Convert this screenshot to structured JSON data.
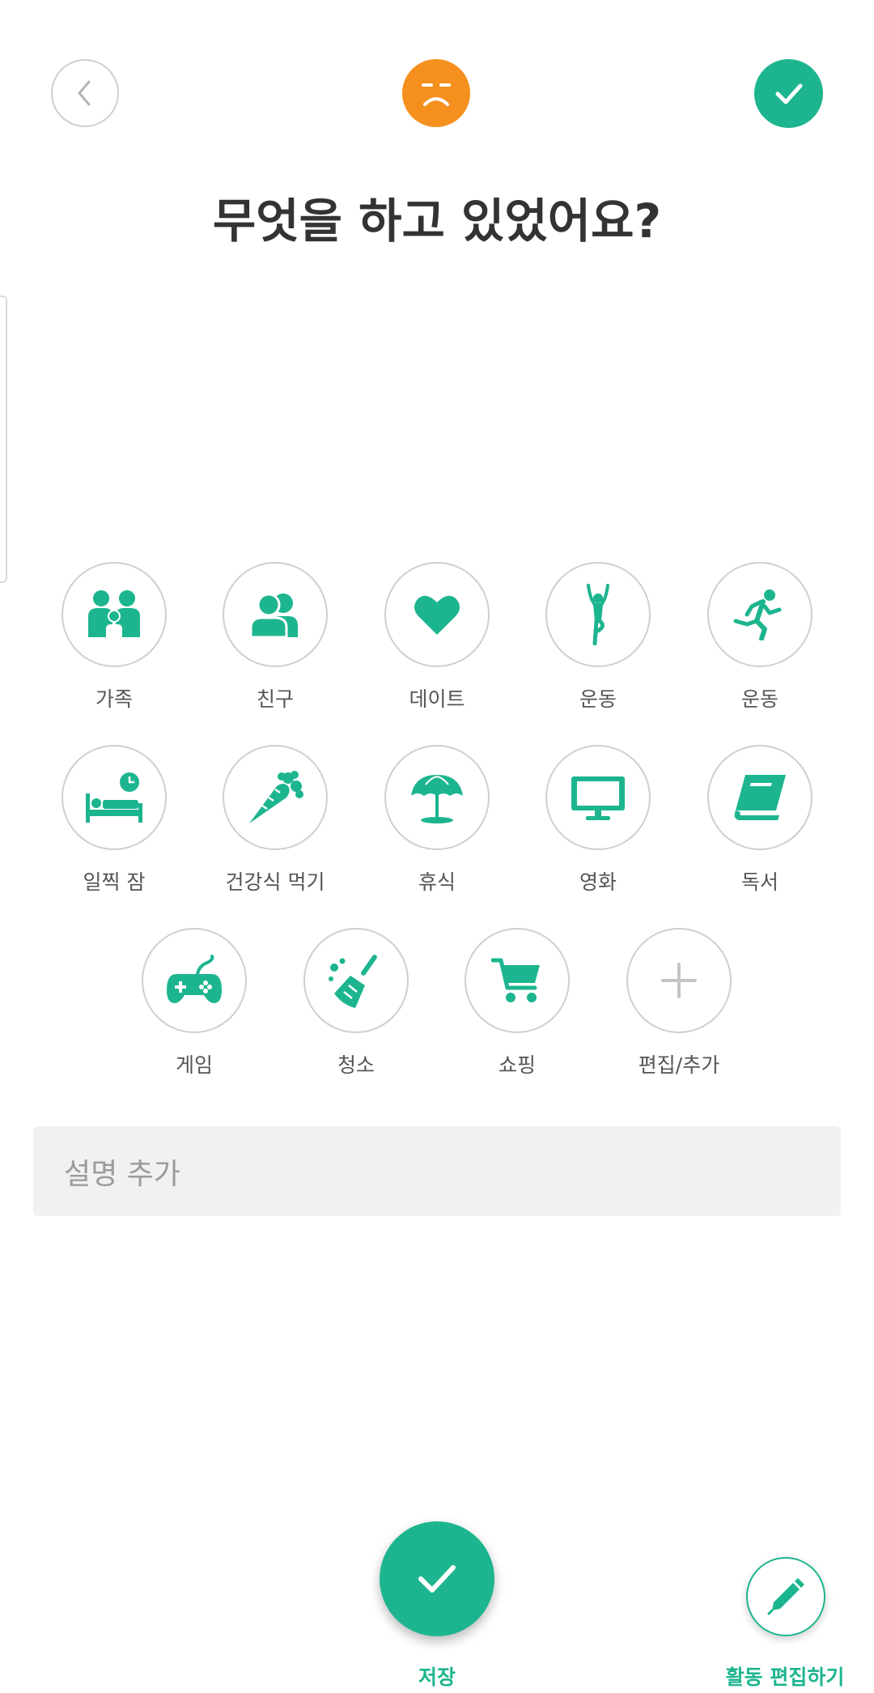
{
  "header": {
    "back_icon": "chevron-left-icon",
    "mood_icon": "sad-face-icon",
    "mood_color": "#f5901f",
    "done_icon": "check-icon",
    "title": "무엇을 하고 있었어요?"
  },
  "accent_color": "#1db58f",
  "activities": [
    {
      "label": "가족",
      "icon": "family-icon"
    },
    {
      "label": "친구",
      "icon": "friends-icon"
    },
    {
      "label": "데이트",
      "icon": "heart-icon"
    },
    {
      "label": "운동",
      "icon": "yoga-icon"
    },
    {
      "label": "운동",
      "icon": "running-icon"
    },
    {
      "label": "일찍 잠",
      "icon": "bed-clock-icon"
    },
    {
      "label": "건강식 먹기",
      "icon": "carrot-icon"
    },
    {
      "label": "휴식",
      "icon": "beach-umbrella-icon"
    },
    {
      "label": "영화",
      "icon": "tv-icon"
    },
    {
      "label": "독서",
      "icon": "book-icon"
    },
    {
      "label": "게임",
      "icon": "gamepad-icon"
    },
    {
      "label": "청소",
      "icon": "broom-icon"
    },
    {
      "label": "쇼핑",
      "icon": "cart-icon"
    },
    {
      "label": "편집/추가",
      "icon": "plus-icon"
    }
  ],
  "description": {
    "placeholder": "설명 추가"
  },
  "footer": {
    "save_label": "저장",
    "save_icon": "check-icon",
    "edit_label": "활동 편집하기",
    "edit_icon": "pencil-icon"
  }
}
